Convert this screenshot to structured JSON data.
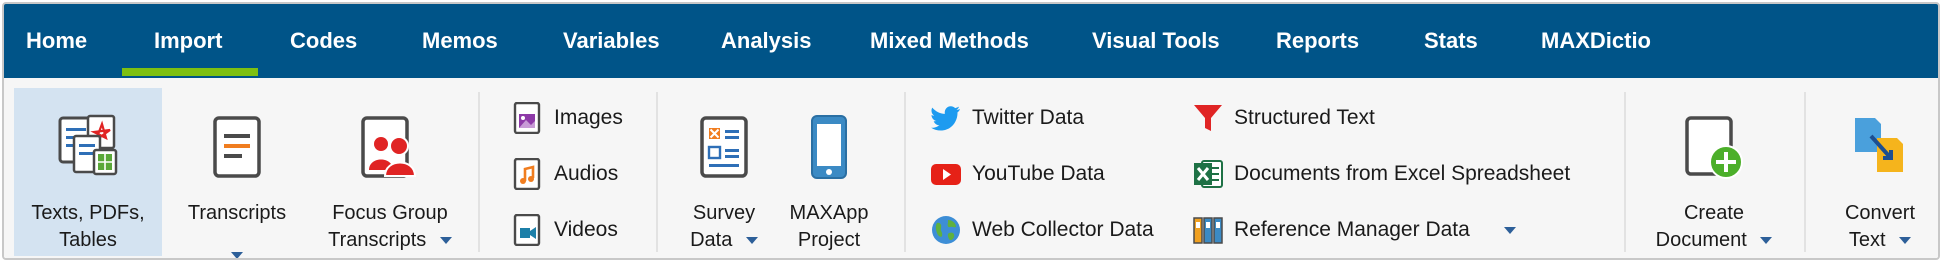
{
  "tabs": [
    {
      "label": "Home"
    },
    {
      "label": "Import",
      "active": true
    },
    {
      "label": "Codes"
    },
    {
      "label": "Memos"
    },
    {
      "label": "Variables"
    },
    {
      "label": "Analysis"
    },
    {
      "label": "Mixed Methods"
    },
    {
      "label": "Visual Tools"
    },
    {
      "label": "Reports"
    },
    {
      "label": "Stats"
    },
    {
      "label": "MAXDictio"
    }
  ],
  "ribbon": {
    "texts_pdfs_tables": {
      "line1": "Texts, PDFs,",
      "line2": "Tables"
    },
    "transcripts": {
      "line1": "Transcripts"
    },
    "focus_group": {
      "line1": "Focus Group",
      "line2": "Transcripts"
    },
    "images": "Images",
    "audios": "Audios",
    "videos": "Videos",
    "survey_data": {
      "line1": "Survey",
      "line2": "Data"
    },
    "maxapp_project": {
      "line1": "MAXApp",
      "line2": "Project"
    },
    "twitter_data": "Twitter Data",
    "youtube_data": "YouTube Data",
    "web_collector_data": "Web Collector Data",
    "structured_text": "Structured Text",
    "documents_from_excel": "Documents from Excel Spreadsheet",
    "reference_manager_data": "Reference Manager Data",
    "create_document": {
      "line1": "Create",
      "line2": "Document"
    },
    "convert_text": {
      "line1": "Convert",
      "line2": "Text"
    }
  },
  "colors": {
    "tabbar_bg": "#005488",
    "active_underline": "#7dc012",
    "selected_button_bg": "#d4e3f1",
    "ribbon_bg": "#f6f6f6"
  }
}
